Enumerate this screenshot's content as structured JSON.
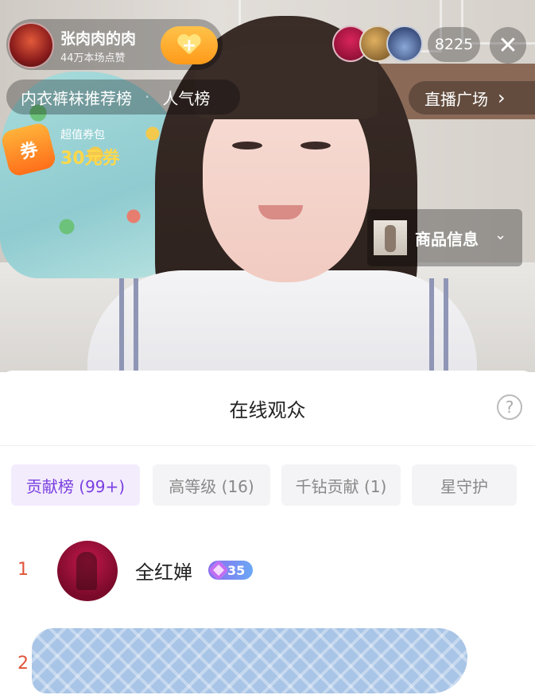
{
  "host": {
    "name": "张肉肉的肉",
    "likes": "44万本场点赞",
    "follow_symbol": "+"
  },
  "viewers": {
    "count": "8225",
    "avatar_colors": [
      "#c0184a",
      "#b88a3a",
      "#2d4a7a"
    ]
  },
  "close_symbol": "✕",
  "rank_bar": {
    "primary": "内衣裤袜推荐榜",
    "separator": "·",
    "secondary": "人气榜"
  },
  "plaza": {
    "label": "直播广场",
    "chevron": "›"
  },
  "coupon": {
    "icon_text": "券",
    "subtitle": "超值券包",
    "value": "30元券"
  },
  "goods": {
    "label": "商品信息",
    "chevron": "⌄"
  },
  "sheet": {
    "title": "在线观众",
    "help_symbol": "?",
    "tabs": [
      {
        "label": "贡献榜 (99+)",
        "active": true
      },
      {
        "label": "高等级 (16)",
        "active": false
      },
      {
        "label": "千钻贡献 (1)",
        "active": false
      },
      {
        "label": "星守护",
        "active": false
      }
    ],
    "rows": [
      {
        "rank": "1",
        "name": "全红婵",
        "level": "35"
      },
      {
        "rank": "2",
        "name": "",
        "level": ""
      }
    ]
  },
  "colors": {
    "accent_purple": "#7a3fe0",
    "rank_red": "#e0543a",
    "coupon_yellow": "#ffd84a",
    "follow_orange": "#ff9a1a"
  }
}
